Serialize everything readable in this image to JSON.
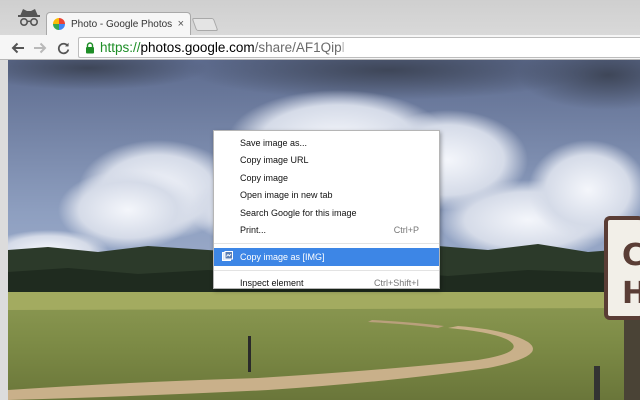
{
  "tab": {
    "title": "Photo - Google Photos",
    "close_glyph": "×"
  },
  "toolbar": {
    "back_glyph": "←",
    "forward_glyph": "→",
    "reload_glyph": "↻"
  },
  "address": {
    "scheme": "https://",
    "host": "photos.google.com",
    "path": "/share/AF1Qip",
    "fade": "l"
  },
  "context_menu": {
    "items": [
      {
        "label": "Save image as...",
        "shortcut": ""
      },
      {
        "label": "Copy image URL",
        "shortcut": ""
      },
      {
        "label": "Copy image",
        "shortcut": ""
      },
      {
        "label": "Open image in new tab",
        "shortcut": ""
      },
      {
        "label": "Search Google for this image",
        "shortcut": ""
      },
      {
        "label": "Print...",
        "shortcut": "Ctrl+P"
      }
    ],
    "extension_item": {
      "label": "Copy image as [IMG]",
      "icon": "extension-icon"
    },
    "inspect_item": {
      "label": "Inspect element",
      "shortcut": "Ctrl+Shift+I"
    }
  },
  "sign": {
    "line1": "C",
    "line2": "H"
  },
  "colors": {
    "highlight": "#3d86e6",
    "secure_green": "#1e8e27"
  }
}
